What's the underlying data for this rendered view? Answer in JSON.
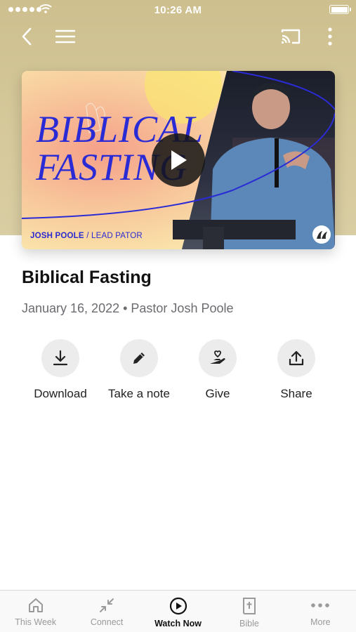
{
  "status_bar": {
    "time": "10:26 AM"
  },
  "video": {
    "thumbnail_title": "BIBLICAL\nFASTING",
    "speaker": "JOSH POOLE",
    "separator": "/",
    "role": "LEAD PATOR"
  },
  "sermon": {
    "title": "Biblical Fasting",
    "meta": "January 16, 2022 • Pastor Josh Poole"
  },
  "actions": [
    {
      "label": "Download",
      "icon": "download-icon"
    },
    {
      "label": "Take a note",
      "icon": "pencil-icon"
    },
    {
      "label": "Give",
      "icon": "give-icon"
    },
    {
      "label": "Share",
      "icon": "share-icon"
    }
  ],
  "tabs": [
    {
      "label": "This Week",
      "icon": "home-icon"
    },
    {
      "label": "Connect",
      "icon": "connect-icon"
    },
    {
      "label": "Watch Now",
      "icon": "play-circle-icon",
      "active": true
    },
    {
      "label": "Bible",
      "icon": "bible-icon"
    },
    {
      "label": "More",
      "icon": "more-dots-icon"
    }
  ],
  "colors": {
    "accent": "#2b2bd6",
    "hero_bg": "#cdbf8e",
    "tab_active": "#111111",
    "tab_inactive": "#9a9a9a"
  }
}
